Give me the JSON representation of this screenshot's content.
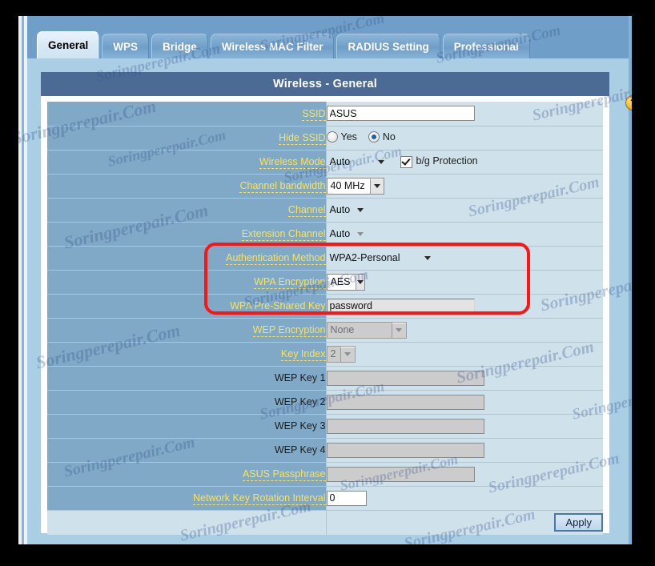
{
  "window": {
    "frame_color": "#000000",
    "page_bg": "#aacee4"
  },
  "tabs": [
    {
      "label": "General",
      "active": true
    },
    {
      "label": "WPS",
      "active": false
    },
    {
      "label": "Bridge",
      "active": false
    },
    {
      "label": "Wireless MAC Filter",
      "active": false
    },
    {
      "label": "RADIUS Setting",
      "active": false
    },
    {
      "label": "Professional",
      "active": false
    }
  ],
  "panel": {
    "title": "Wireless - General",
    "title_bar_color": "#4b6b95",
    "help_icon": "question-mark-icon"
  },
  "form": {
    "label_color": "#ffe24f",
    "label_bg": "#7fa9c6",
    "value_bg": "#cfe2ec",
    "rows": [
      {
        "label": "SSID",
        "value": "ASUS"
      },
      {
        "label": "Hide SSID",
        "yes": "Yes",
        "no": "No",
        "selected": "No"
      },
      {
        "label": "Wireless Mode",
        "value": "Auto",
        "checkbox_label": "b/g Protection",
        "checkbox_checked": true
      },
      {
        "label": "Channel bandwidth",
        "value": "40 MHz"
      },
      {
        "label": "Channel",
        "value": "Auto"
      },
      {
        "label": "Extension Channel",
        "value": "Auto"
      },
      {
        "label": "Authentication Method",
        "value": "WPA2-Personal"
      },
      {
        "label": "WPA Encryption",
        "value": "AES"
      },
      {
        "label": "WPA Pre-Shared Key",
        "value": "password"
      },
      {
        "label": "WEP Encryption",
        "value": "None"
      },
      {
        "label": "Key Index",
        "value": "2"
      },
      {
        "label": "WEP Key 1",
        "value": ""
      },
      {
        "label": "WEP Key 2",
        "value": ""
      },
      {
        "label": "WEP Key 3",
        "value": ""
      },
      {
        "label": "WEP Key 4",
        "value": ""
      },
      {
        "label": "ASUS Passphrase",
        "value": ""
      },
      {
        "label": "Network Key Rotation Interval",
        "value": "0"
      }
    ]
  },
  "footer": {
    "apply_label": "Apply"
  },
  "highlight": {
    "color": "#ff1414",
    "covers": [
      "Extension Channel",
      "Authentication Method",
      "WPA Encryption"
    ]
  },
  "watermarks": {
    "text": "Soringperepair.Com",
    "color": "#33508c"
  }
}
